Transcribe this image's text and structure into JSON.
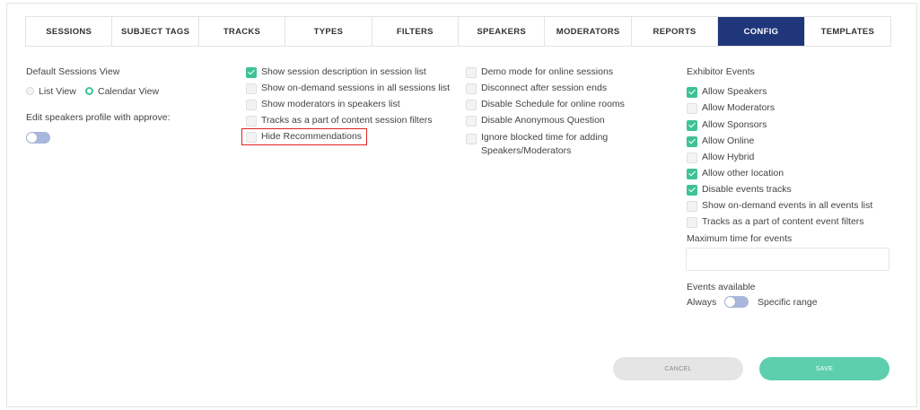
{
  "tabs": [
    {
      "label": "SESSIONS",
      "active": false
    },
    {
      "label": "SUBJECT TAGS",
      "active": false
    },
    {
      "label": "TRACKS",
      "active": false
    },
    {
      "label": "TYPES",
      "active": false
    },
    {
      "label": "FILTERS",
      "active": false
    },
    {
      "label": "SPEAKERS",
      "active": false
    },
    {
      "label": "MODERATORS",
      "active": false
    },
    {
      "label": "REPORTS",
      "active": false
    },
    {
      "label": "CONFIG",
      "active": true
    },
    {
      "label": "TEMPLATES",
      "active": false
    }
  ],
  "col1": {
    "default_view_label": "Default Sessions View",
    "list_view": "List View",
    "calendar_view": "Calendar View",
    "selected_view": "Calendar View",
    "edit_speakers_label": "Edit speakers profile with approve:",
    "edit_speakers_toggle": "off"
  },
  "col2": [
    {
      "label": "Show session description in session list",
      "checked": true
    },
    {
      "label": "Show on-demand sessions in all sessions list",
      "checked": false
    },
    {
      "label": "Show moderators in speakers list",
      "checked": false
    },
    {
      "label": "Tracks as a part of content session filters",
      "checked": false
    },
    {
      "label": "Hide Recommendations",
      "checked": false,
      "highlighted": true
    }
  ],
  "col3": [
    {
      "label": "Demo mode for online sessions",
      "checked": false
    },
    {
      "label": "Disconnect after session ends",
      "checked": false
    },
    {
      "label": "Disable Schedule for online rooms",
      "checked": false
    },
    {
      "label": "Disable Anonymous Question",
      "checked": false
    },
    {
      "label": "Ignore blocked time for adding Speakers/Moderators",
      "checked": false
    }
  ],
  "col4": {
    "title": "Exhibitor Events",
    "items": [
      {
        "label": "Allow Speakers",
        "checked": true
      },
      {
        "label": "Allow Moderators",
        "checked": false
      },
      {
        "label": "Allow Sponsors",
        "checked": true
      },
      {
        "label": "Allow Online",
        "checked": true
      },
      {
        "label": "Allow Hybrid",
        "checked": false
      },
      {
        "label": "Allow other location",
        "checked": true
      },
      {
        "label": "Disable events tracks",
        "checked": true
      },
      {
        "label": "Show on-demand events in all events list",
        "checked": false
      },
      {
        "label": "Tracks as a part of content event filters",
        "checked": false
      }
    ],
    "max_time_label": "Maximum time for events",
    "max_time_value": "",
    "events_available_label": "Events available",
    "always": "Always",
    "specific_range": "Specific range",
    "events_available_toggle": "off"
  },
  "actions": {
    "cancel": "CANCEL",
    "save": "SAVE"
  },
  "colors": {
    "active_tab": "#20367a",
    "check": "#3ec295",
    "save": "#5dcfad",
    "highlight": "#e02020",
    "toggle": "#a8b7db"
  }
}
